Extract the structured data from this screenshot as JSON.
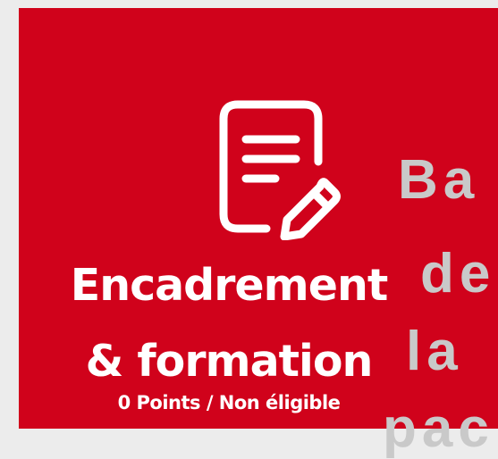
{
  "card": {
    "icon": "document-pencil-icon",
    "title_line1": "Encadrement",
    "title_line2": "& formation",
    "points": "0 Points / Non éligible",
    "background_color": "#d0021b"
  },
  "overlay_text": {
    "line1": "Ba",
    "line2": "de",
    "line3": "la",
    "line4": "pac"
  }
}
